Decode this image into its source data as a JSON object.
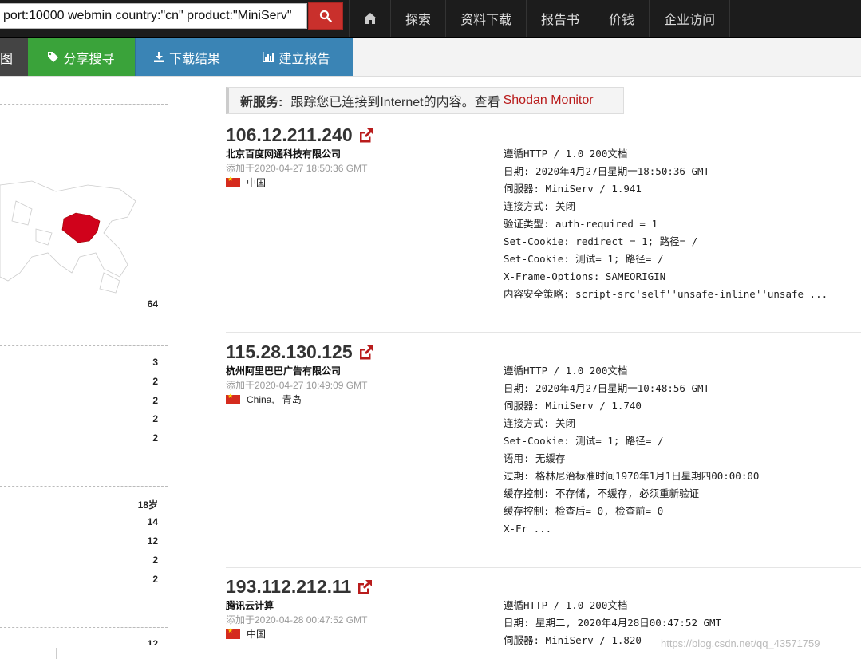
{
  "search": {
    "value": "port:10000 webmin country:\"cn\" product:\"MiniServ\""
  },
  "nav": {
    "items": [
      "探索",
      "资料下载",
      "报告书",
      "价钱",
      "企业访问"
    ]
  },
  "actions": {
    "map": "图",
    "share": "分享搜寻",
    "download": "下载结果",
    "report": "建立报告"
  },
  "sidebar": {
    "map_total": "64",
    "group1": [
      "3",
      "2",
      "2",
      "2",
      "2"
    ],
    "group2": [
      "18岁",
      "14",
      "12",
      "2",
      "2"
    ],
    "cut_value": "12"
  },
  "banner": {
    "label": "新服务:",
    "text": "跟踪您已连接到Internet的内容。查看",
    "link": "Shodan Monitor"
  },
  "results": [
    {
      "ip": "106.12.211.240",
      "org": "北京百度网通科技有限公司",
      "added": "添加于2020-04-27 18:50:36 GMT",
      "location": "中国",
      "banner": "遵循HTTP / 1.0 200文档\n日期: 2020年4月27日星期一18:50:36 GMT\n伺服器: MiniServ / 1.941\n连接方式: 关闭\n验证类型: auth-required = 1\nSet-Cookie: redirect = 1; 路径= /\nSet-Cookie: 测试= 1; 路径= /\nX-Frame-Options: SAMEORIGIN\n内容安全策略: script-src'self''unsafe-inline''unsafe ..."
    },
    {
      "ip": "115.28.130.125",
      "org": "杭州阿里巴巴广告有限公司",
      "added": "添加于2020-04-27 10:49:09 GMT",
      "location": "China,   青岛",
      "banner": "遵循HTTP / 1.0 200文档\n日期: 2020年4月27日星期一10:48:56 GMT\n伺服器: MiniServ / 1.740\n连接方式: 关闭\nSet-Cookie: 测试= 1; 路径= /\n语用: 无缓存\n过期: 格林尼治标准时间1970年1月1日星期四00:00:00\n缓存控制: 不存储, 不缓存, 必须重新验证\n缓存控制: 检查后= 0, 检查前= 0\nX-Fr ..."
    },
    {
      "ip": "193.112.212.11",
      "org": "腾讯云计算",
      "added": "添加于2020-04-28 00:47:52 GMT",
      "location": "中国",
      "banner": "遵循HTTP / 1.0 200文档\n日期: 星期二, 2020年4月28日00:47:52 GMT\n伺服器: MiniServ / 1.820"
    }
  ],
  "watermark": "https://blog.csdn.net/qq_43571759",
  "colors": {
    "search_button": "#c9302c",
    "share": "#3aa33a",
    "action_blue": "#3a84b5",
    "highlight_country": "#d0021b"
  }
}
